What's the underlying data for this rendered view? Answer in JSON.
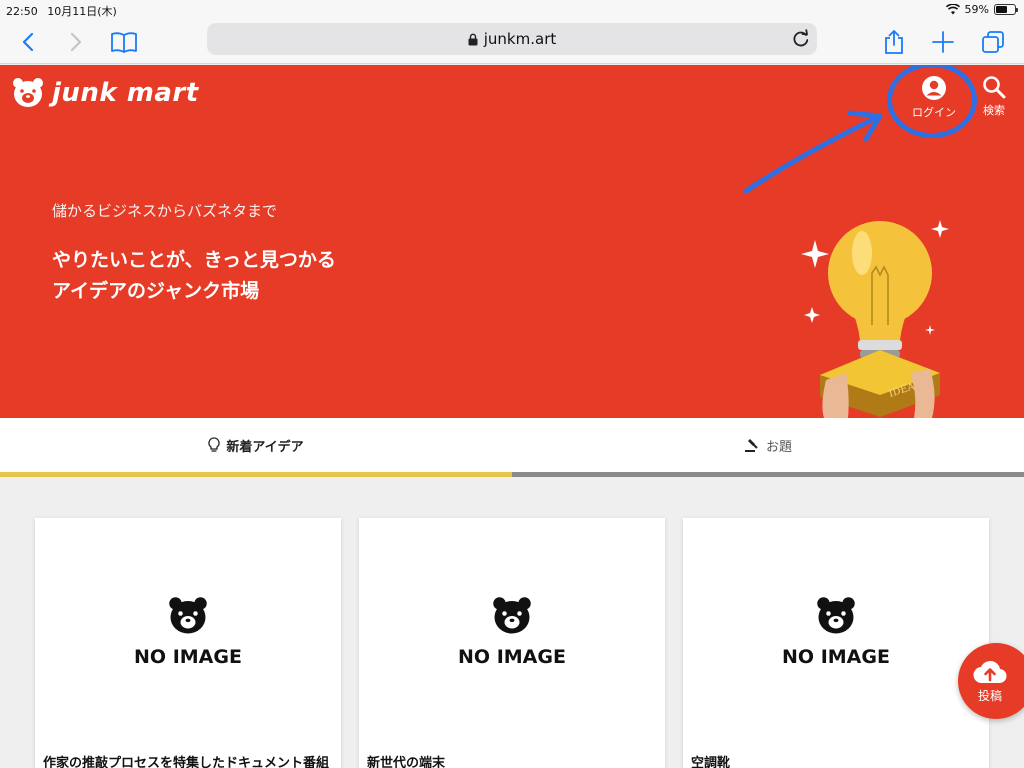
{
  "status": {
    "time": "22:50",
    "date": "10月11日(木)",
    "battery": "59%",
    "battery_level": 0.59
  },
  "browser": {
    "url": "junkm.art"
  },
  "header": {
    "logo_text": "junk mart",
    "login_label": "ログイン",
    "search_label": "検索"
  },
  "hero": {
    "tagline_small": "儲かるビジネスからバズネタまで",
    "tagline_line1": "やりたいことが、きっと見つかる",
    "tagline_line2": "アイデアのジャンク市場",
    "bulb_label": "IDEA"
  },
  "tabs": [
    {
      "label": "新着アイデア",
      "icon": "lightbulb-icon",
      "active": true
    },
    {
      "label": "お題",
      "icon": "gavel-icon",
      "active": false
    }
  ],
  "cards": [
    {
      "image_text": "NO IMAGE",
      "title": "作家の推敲プロセスを特集したドキュメント番組"
    },
    {
      "image_text": "NO IMAGE",
      "title": "新世代の端末"
    },
    {
      "image_text": "NO IMAGE",
      "title": "空調靴"
    }
  ],
  "fab": {
    "label": "投稿",
    "icon": "cloud-upload-icon"
  },
  "colors": {
    "brand": "#e63b27",
    "active_tab": "#e4c64a",
    "annotation": "#2f6fe4"
  }
}
